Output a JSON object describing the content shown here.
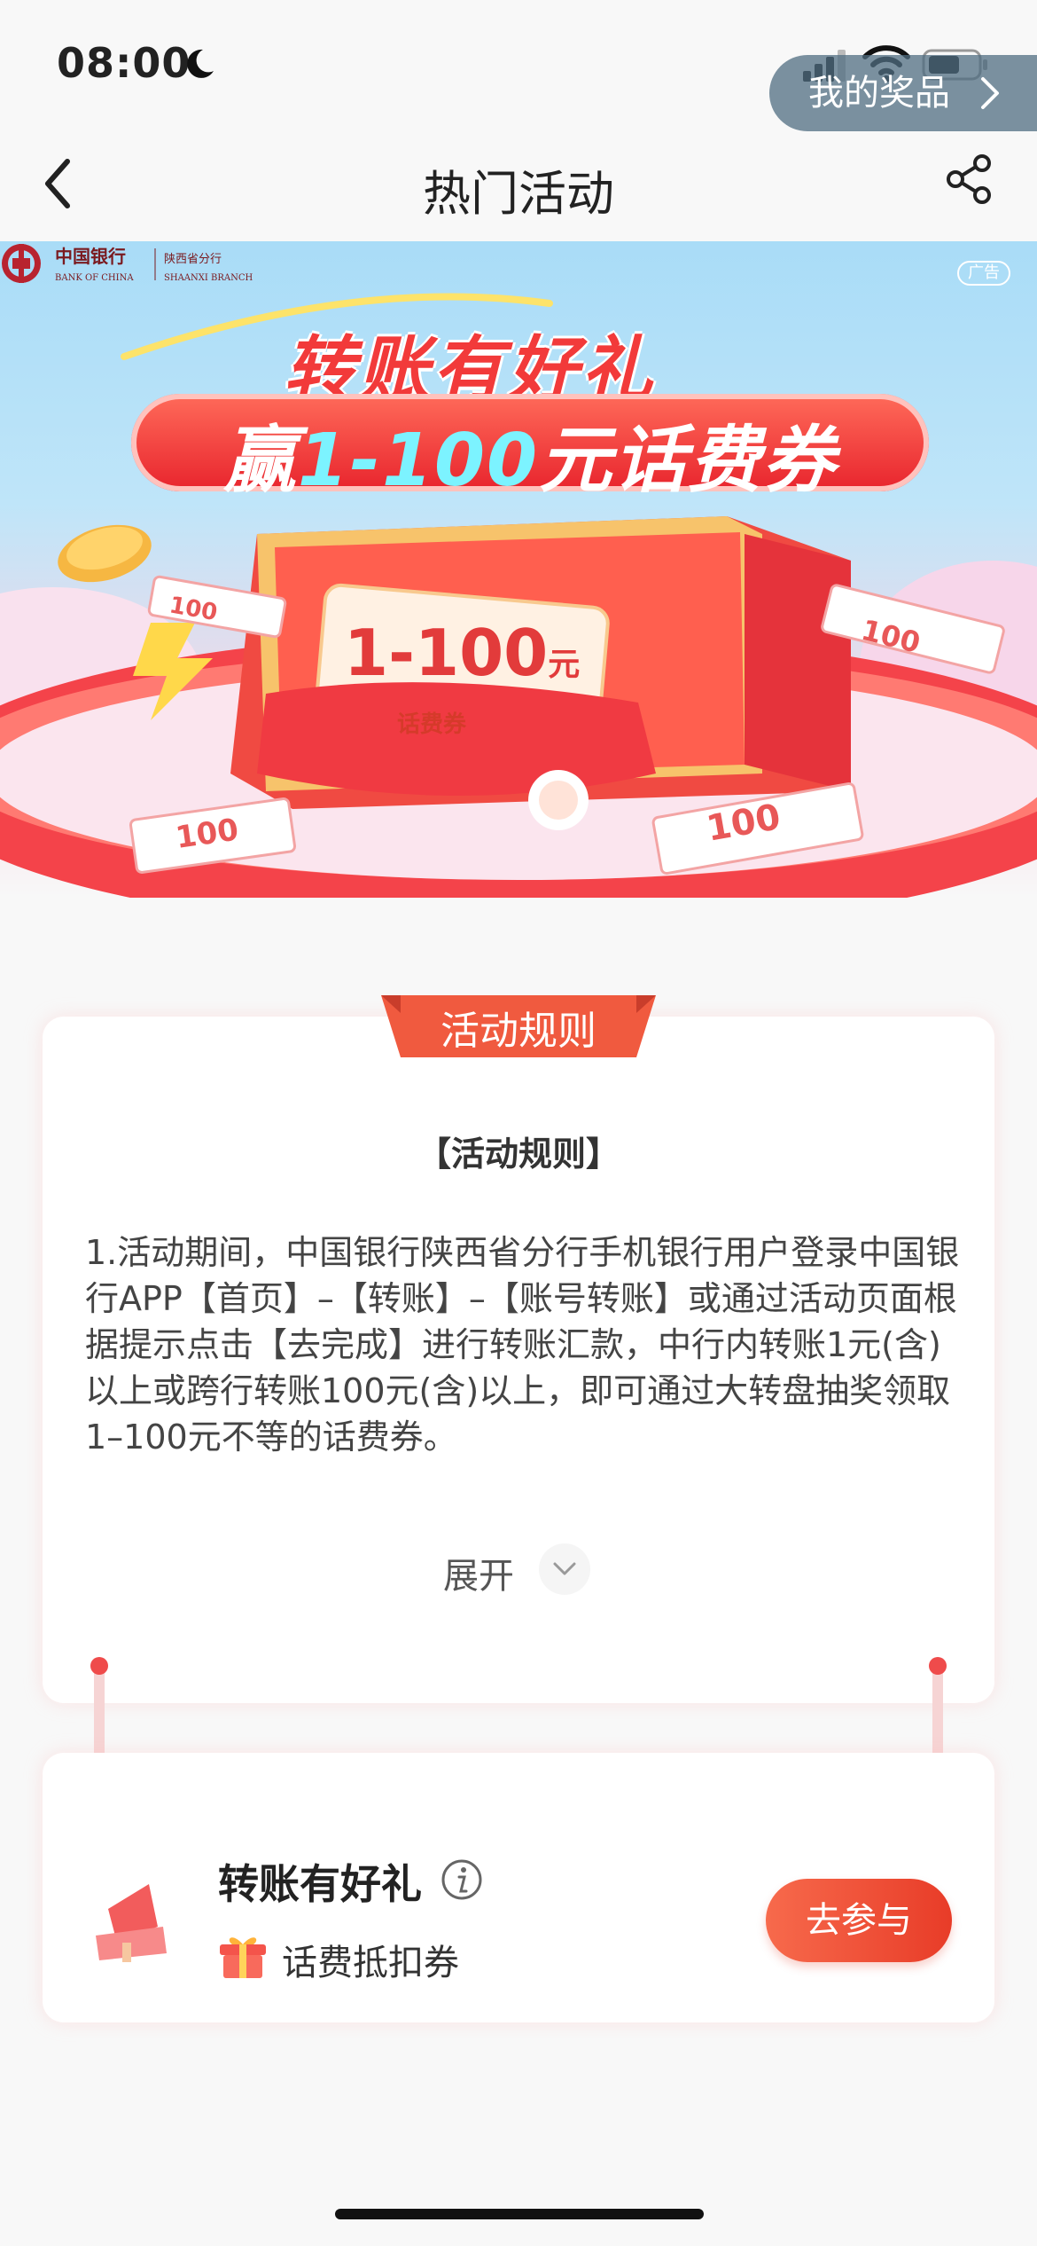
{
  "status_bar": {
    "time": "08:00"
  },
  "nav": {
    "title": "热门活动"
  },
  "banner": {
    "bank_name_cn": "中国银行",
    "bank_name_en": "BANK OF CHINA",
    "branch_cn": "陕西省分行",
    "branch_en": "SHAANXI BRANCH",
    "ad_tag": "广告",
    "my_prizes": "我的奖品",
    "headline": "转账有好礼",
    "subhead_prefix": "赢",
    "subhead_highlight": "1-100",
    "subhead_suffix": "元话费券",
    "ticket_amount": "1-100",
    "ticket_unit": "元",
    "ticket_label": "话费券",
    "deco_number": "100"
  },
  "rules": {
    "tab_label": "活动规则",
    "heading": "【活动规则】",
    "body": "1.活动期间，中国银行陕西省分行手机银行用户登录中国银行APP【首页】–【转账】–【账号转账】或通过活动页面根据提示点击【去完成】进行转账汇款，中行内转账1元(含)以上或跨行转账100元(含)以上，即可通过大转盘抽奖领取1–100元不等的话费券。",
    "expand_label": "展开"
  },
  "activity": {
    "title": "转账有好礼",
    "subtitle": "话费抵扣券",
    "join_label": "去参与"
  },
  "colors": {
    "accent": "#e83c28",
    "brand_red": "#b8232f",
    "connector": "#f6d4d4"
  }
}
